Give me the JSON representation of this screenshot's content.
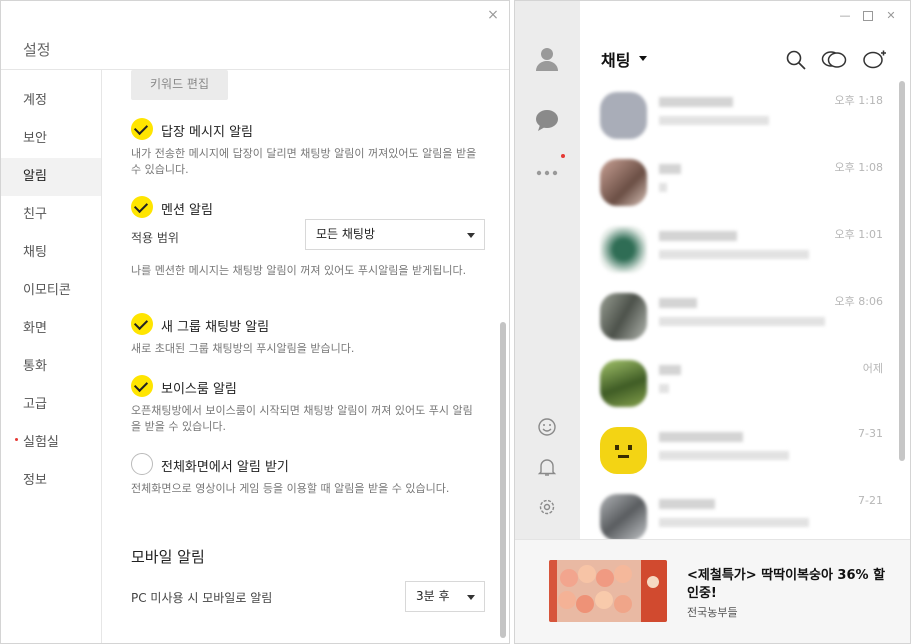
{
  "settings": {
    "title": "설정",
    "close_glyph": "×",
    "nav": [
      {
        "label": "계정",
        "active": false,
        "dot": false
      },
      {
        "label": "보안",
        "active": false,
        "dot": false
      },
      {
        "label": "알림",
        "active": true,
        "dot": false
      },
      {
        "label": "친구",
        "active": false,
        "dot": false
      },
      {
        "label": "채팅",
        "active": false,
        "dot": false
      },
      {
        "label": "이모티콘",
        "active": false,
        "dot": false
      },
      {
        "label": "화면",
        "active": false,
        "dot": false
      },
      {
        "label": "통화",
        "active": false,
        "dot": false
      },
      {
        "label": "고급",
        "active": false,
        "dot": false
      },
      {
        "label": "실험실",
        "active": false,
        "dot": true
      },
      {
        "label": "정보",
        "active": false,
        "dot": false
      }
    ],
    "keyword_edit_label": "키워드 편집",
    "options": {
      "reply": {
        "label": "답장 메시지 알림",
        "checked": true,
        "desc": "내가 전송한 메시지에 답장이 달리면 채팅방 알림이 꺼져있어도 알림을 받을 수 있습니다."
      },
      "mention": {
        "label": "멘션 알림",
        "checked": true,
        "desc": "나를 멘션한 메시지는 채팅방 알림이 꺼져 있어도 푸시알림을 받게됩니다."
      },
      "new_group": {
        "label": "새 그룹 채팅방 알림",
        "checked": true,
        "desc": "새로 초대된 그룹 채팅방의 푸시알림을 받습니다."
      },
      "voiceroom": {
        "label": "보이스룸 알림",
        "checked": true,
        "desc": "오픈채팅방에서 보이스룸이 시작되면 채팅방 알림이 꺼져 있어도 푸시 알림을 받을 수 있습니다."
      },
      "fullscreen": {
        "label": "전체화면에서 알림 받기",
        "checked": false,
        "desc": "전체화면으로 영상이나 게임 등을 이용할 때 알림을 받을 수 있습니다."
      }
    },
    "range": {
      "label": "적용 범위",
      "value": "모든 채팅방"
    },
    "mobile_section": {
      "title": "모바일 알림",
      "label": "PC 미사용 시 모바일로 알림",
      "value": "3분 후"
    }
  },
  "chat": {
    "title": "채팅",
    "window_controls": [
      "minimize",
      "maximize",
      "close"
    ],
    "sidebar_icons": [
      "friends-icon",
      "chat-icon",
      "more-icon",
      "emoticon-icon",
      "bell-icon",
      "settings-icon"
    ],
    "header_icons": [
      "search-icon",
      "open-chat-icon",
      "new-chat-icon"
    ],
    "rooms": [
      {
        "time": "오후 1:18",
        "avatar_color": "#a9adb8"
      },
      {
        "time": "오후 1:08",
        "avatar_color": "#9b7f73"
      },
      {
        "time": "오후 1:01",
        "avatar_color": "#5b8a74"
      },
      {
        "time": "오후 8:06",
        "avatar_color": "#7b7f78"
      },
      {
        "time": "어제",
        "avatar_color": "#5e7a3c"
      },
      {
        "time": "7-31",
        "avatar_color": "#f3d414"
      },
      {
        "time": "7-21",
        "avatar_color": "#8a8d8f"
      }
    ],
    "ad": {
      "title": "<제철특가> 딱딱이복숭아 36% 할인중!",
      "subtitle": "전국농부들"
    },
    "accent_color": "#ffe500",
    "notice_dot_color": "#e53935"
  }
}
